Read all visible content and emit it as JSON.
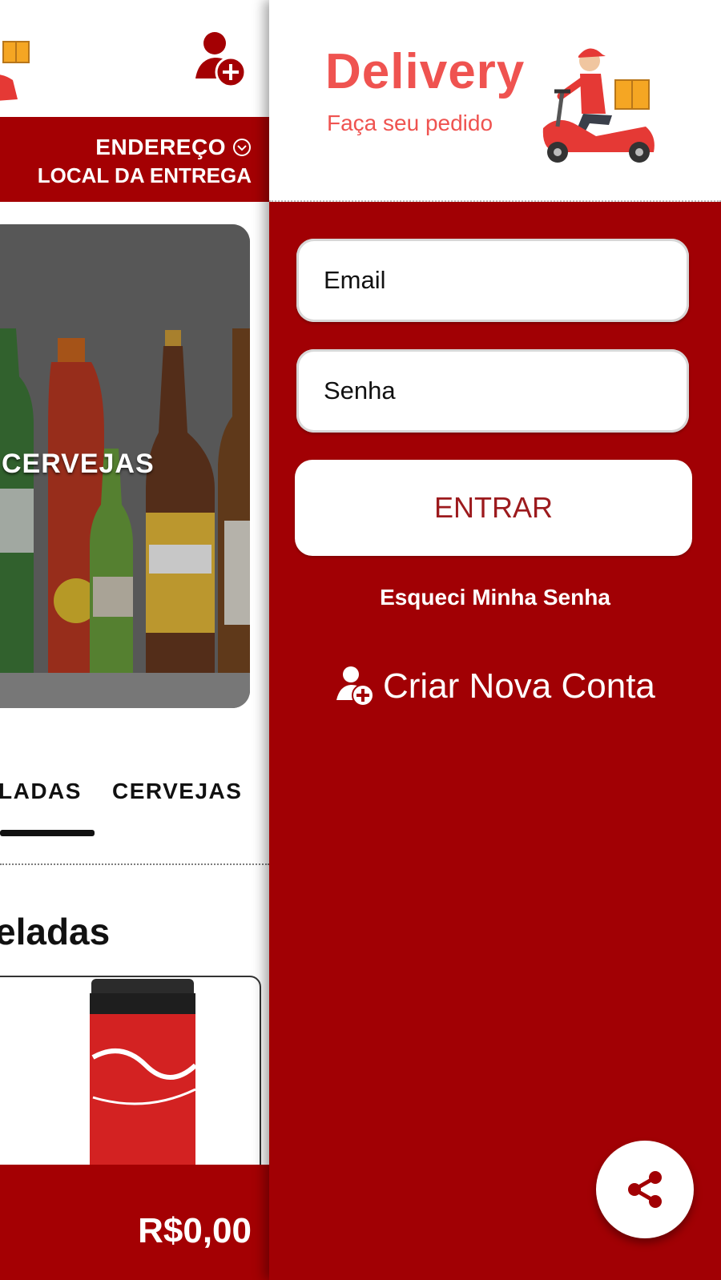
{
  "header": {
    "add_user_icon": "add-user-icon",
    "scooter_icon": "delivery-scooter-icon"
  },
  "address": {
    "title": "ENDEREÇO",
    "subtitle": "LOCAL DA ENTREGA",
    "icon": "chevron-circle-down-icon"
  },
  "banner": {
    "label": "CERVEJAS"
  },
  "tabs": [
    {
      "label": "LADAS",
      "active": true
    },
    {
      "label": "CERVEJAS",
      "active": false
    }
  ],
  "section": {
    "title": "eladas"
  },
  "cart": {
    "total": "R$0,00"
  },
  "drawer": {
    "brand_title": "Delivery",
    "brand_subtitle": "Faça seu pedido",
    "email_placeholder": "Email",
    "password_placeholder": "Senha",
    "login_label": "ENTRAR",
    "forgot_label": "Esqueci Minha Senha",
    "create_account_label": "Criar Nova Conta",
    "share_icon": "share-icon"
  },
  "colors": {
    "primary_red": "#a10004",
    "brand_coral": "#ef5350",
    "button_text": "#9c1a1d",
    "white": "#ffffff"
  }
}
